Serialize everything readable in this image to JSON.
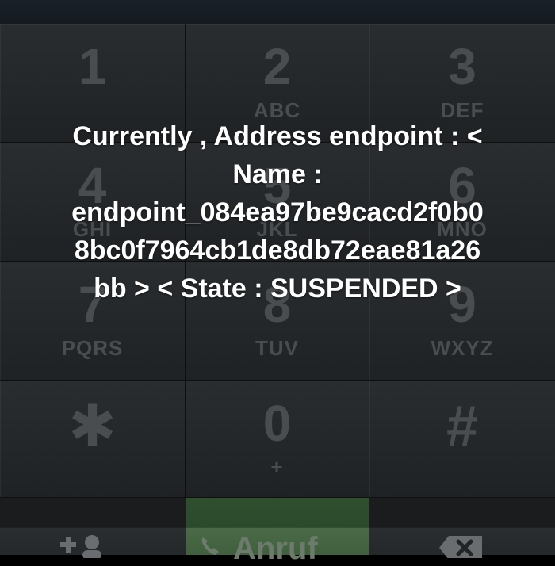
{
  "keypad": {
    "keys": [
      {
        "digit": "1",
        "letters": ""
      },
      {
        "digit": "2",
        "letters": "ABC"
      },
      {
        "digit": "3",
        "letters": "DEF"
      },
      {
        "digit": "4",
        "letters": "GHI"
      },
      {
        "digit": "5",
        "letters": "JKL"
      },
      {
        "digit": "6",
        "letters": "MNO"
      },
      {
        "digit": "7",
        "letters": "PQRS"
      },
      {
        "digit": "8",
        "letters": "TUV"
      },
      {
        "digit": "9",
        "letters": "WXYZ"
      },
      {
        "digit": "✱",
        "letters": ""
      },
      {
        "digit": "0",
        "letters": "+"
      },
      {
        "digit": "#",
        "letters": ""
      }
    ]
  },
  "bottom_bar": {
    "add_contact_icon": "add-contact-icon",
    "call_label": "Anruf",
    "call_icon": "phone-icon",
    "delete_icon": "backspace-icon",
    "call_color": "#3f5f3d"
  },
  "overlay": {
    "lines": [
      "Currently , Address endpoint : <",
      "Name :",
      "endpoint_084ea97be9cacd2f0b0",
      "8bc0f7964cb1de8db72eae81a26",
      "bb > < State : SUSPENDED >"
    ]
  }
}
